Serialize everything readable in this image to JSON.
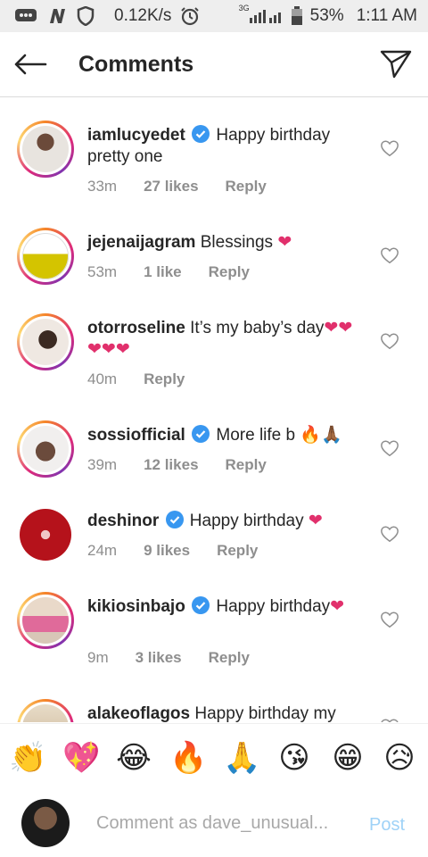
{
  "status_bar": {
    "speed": "0.12K/s",
    "network": "3G",
    "battery": "53%",
    "time": "1:11 AM",
    "icons": [
      "message-icon",
      "n-icon",
      "shield-icon",
      "alarm-icon",
      "signal-icon",
      "battery-icon"
    ]
  },
  "header": {
    "title": "Comments",
    "back_icon": "arrow-left-icon",
    "send_icon": "paper-plane-icon"
  },
  "comments": [
    {
      "username": "iamlucyedet",
      "verified": true,
      "text": "Happy birthday pretty one",
      "emoji": "",
      "time": "33m",
      "likes": "27 likes",
      "reply": "Reply"
    },
    {
      "username": "jejenaijagram",
      "verified": false,
      "text": "Blessings",
      "emoji": "❤",
      "time": "53m",
      "likes": "1 like",
      "reply": "Reply"
    },
    {
      "username": "otorroseline",
      "verified": false,
      "text": "It’s my baby’s day",
      "emoji": "❤❤❤❤❤",
      "time": "40m",
      "likes": "",
      "reply": "Reply"
    },
    {
      "username": "sossiofficial",
      "verified": true,
      "text": "More life b",
      "emoji": "🔥🙏🏾",
      "time": "39m",
      "likes": "12 likes",
      "reply": "Reply"
    },
    {
      "username": "deshinor",
      "verified": true,
      "text": "Happy birthday",
      "emoji": "❤",
      "time": "24m",
      "likes": "9 likes",
      "reply": "Reply"
    },
    {
      "username": "kikiosinbajo",
      "verified": true,
      "text": "Happy birthday",
      "emoji": "❤",
      "time": "9m",
      "likes": "3 likes",
      "reply": "Reply"
    },
    {
      "username": "alakeoflagos",
      "verified": false,
      "text": "Happy birthday my",
      "emoji": "",
      "time": "",
      "likes": "",
      "reply": ""
    }
  ],
  "emoji_bar": [
    "👏",
    "💖",
    "😂",
    "🔥",
    "🙏",
    "😘",
    "😁",
    "😥"
  ],
  "composer": {
    "placeholder": "Comment as dave_unusual...",
    "post_label": "Post"
  },
  "colors": {
    "accent_blue": "#3897f0",
    "post_disabled": "#9fd2f7",
    "heart_pink": "#e1306c",
    "meta_gray": "#8e8e8e"
  }
}
